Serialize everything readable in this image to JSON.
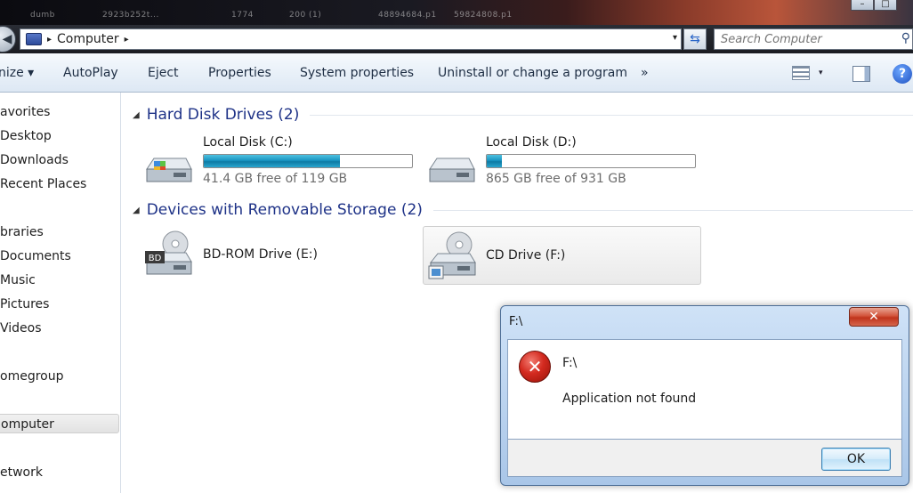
{
  "window": {
    "caption_buttons": [
      "–",
      "□"
    ],
    "background_items": [
      "dumb",
      "2923b252t...",
      "1774",
      "200 (1)",
      "48894684.p1",
      "59824808.p1"
    ]
  },
  "address_bar": {
    "location_icon": "computer-icon",
    "breadcrumb": "Computer",
    "separator": "▸",
    "dropdown": "▾",
    "refresh_symbol": "⇆"
  },
  "search": {
    "placeholder": "Search Computer",
    "icon": "search-icon"
  },
  "command_bar": {
    "organize": "nize ▾",
    "autoplay": "AutoPlay",
    "eject": "Eject",
    "properties": "Properties",
    "system_properties": "System properties",
    "uninstall": "Uninstall or change a program",
    "more": "»",
    "view_dropdown": "▾",
    "help": "?"
  },
  "nav": {
    "items": [
      "avorites",
      "Desktop",
      "Downloads",
      "Recent Places",
      "braries",
      "Documents",
      "Music",
      "Pictures",
      "Videos",
      "omegroup",
      "omputer",
      "etwork"
    ]
  },
  "groups": {
    "hard_disks": {
      "title": "Hard Disk Drives (2)",
      "expander": "◢"
    },
    "removable": {
      "title": "Devices with Removable Storage (2)",
      "expander": "◢"
    }
  },
  "drives": {
    "c": {
      "name": "Local Disk (C:)",
      "free_text": "41.4 GB free of 119 GB",
      "used_fraction": 0.652
    },
    "d": {
      "name": "Local Disk (D:)",
      "free_text": "865 GB free of 931 GB",
      "used_fraction": 0.071
    },
    "e": {
      "name": "BD-ROM Drive (E:)",
      "badge": "BD"
    },
    "f": {
      "name": "CD Drive (F:)"
    }
  },
  "dialog": {
    "title": "F:\\",
    "close_symbol": "✕",
    "heading": "F:\\",
    "message": "Application not found",
    "ok_label": "OK",
    "error_symbol": "✕"
  },
  "colors": {
    "group_title": "#1e3287",
    "drive_bar_fill": "#1a95c2",
    "close_button": "#c0331b"
  }
}
